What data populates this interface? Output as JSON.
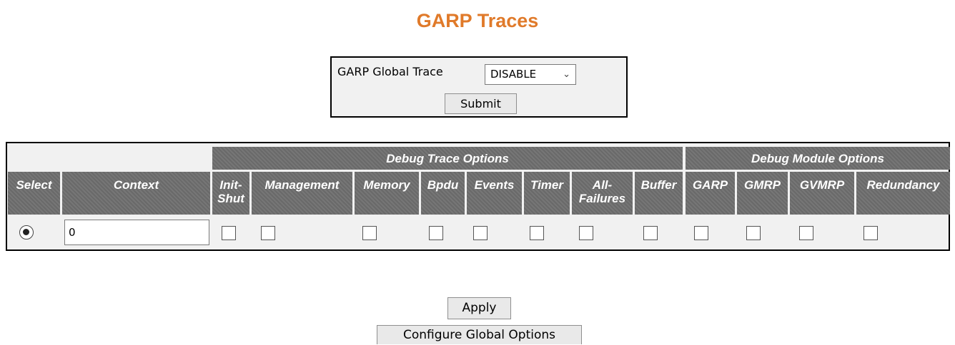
{
  "page": {
    "title": "GARP Traces"
  },
  "global_trace": {
    "label": "GARP Global Trace",
    "select_value": "DISABLE",
    "submit_label": "Submit"
  },
  "table": {
    "group_headers": {
      "trace": "Debug Trace Options",
      "module": "Debug Module Options"
    },
    "columns": {
      "select": "Select",
      "context": "Context",
      "init_shut_1": "Init-",
      "init_shut_2": "Shut",
      "management": "Management",
      "memory": "Memory",
      "bpdu": "Bpdu",
      "events": "Events",
      "timer": "Timer",
      "all_failures_1": "All-",
      "all_failures_2": "Failures",
      "buffer": "Buffer",
      "garp": "GARP",
      "gmrp": "GMRP",
      "gvmrp": "GVMRP",
      "redundancy": "Redundancy"
    },
    "row": {
      "selected": true,
      "context_value": "0",
      "checks": {
        "init_shut": false,
        "management": false,
        "memory": false,
        "bpdu": false,
        "events": false,
        "timer": false,
        "all_failures": false,
        "buffer": false,
        "garp": false,
        "gmrp": false,
        "gvmrp": false,
        "redundancy": false
      }
    }
  },
  "actions": {
    "apply": "Apply",
    "configure_global": "Configure Global Options"
  },
  "colors": {
    "title": "#e07a2a",
    "header_bg": "#6f6f6f",
    "panel_bg": "#f1f1f1"
  }
}
